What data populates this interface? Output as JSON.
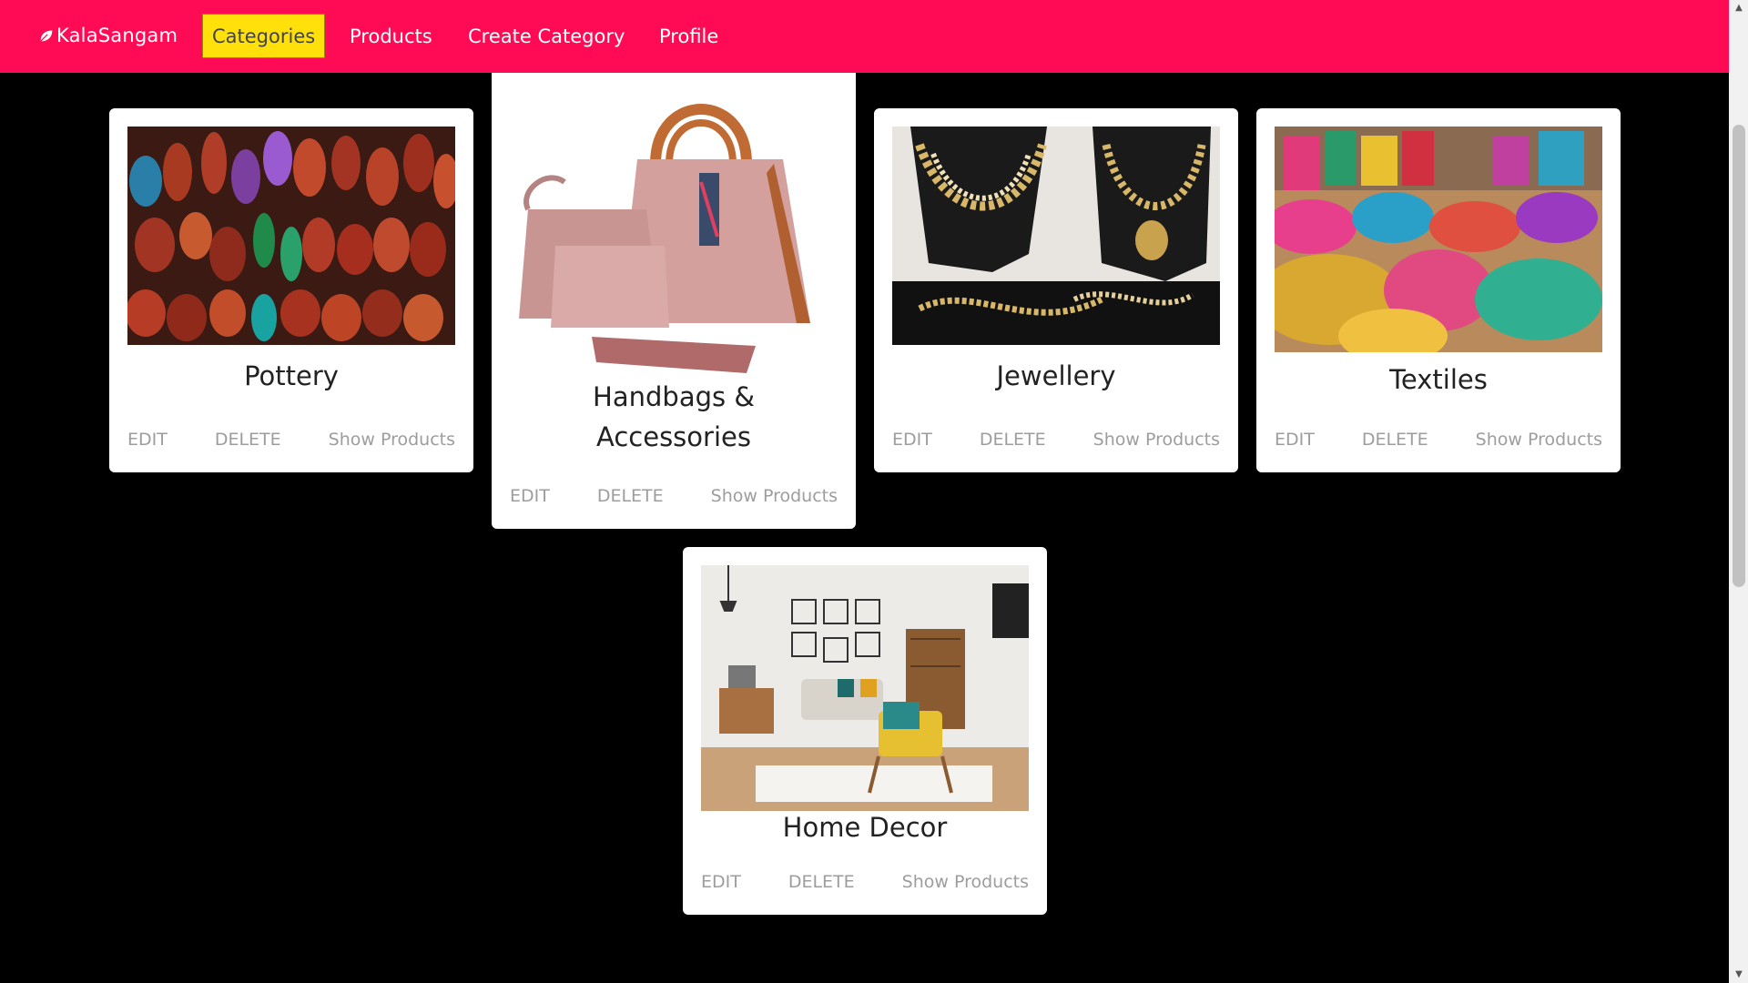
{
  "nav": {
    "brand": "KalaSangam",
    "links": [
      "Categories",
      "Products",
      "Create Category",
      "Profile"
    ],
    "active_index": 0,
    "colors": {
      "bar": "#ff0a54",
      "active_bg": "#ffe00a"
    }
  },
  "categories": [
    {
      "title": "Pottery",
      "image_icon": "pottery-photo",
      "edit": "EDIT",
      "delete": "DELETE",
      "show": "Show Products"
    },
    {
      "title_line1": "Handbags &",
      "title_line2": "Accessories",
      "image_icon": "handbag-photo",
      "edit": "EDIT",
      "delete": "DELETE",
      "show": "Show Products"
    },
    {
      "title": "Jewellery",
      "image_icon": "jewellery-photo",
      "edit": "EDIT",
      "delete": "DELETE",
      "show": "Show Products"
    },
    {
      "title": "Textiles",
      "image_icon": "textiles-photo",
      "edit": "EDIT",
      "delete": "DELETE",
      "show": "Show Products"
    },
    {
      "title": "Home Decor",
      "image_icon": "living-room-photo",
      "edit": "EDIT",
      "delete": "DELETE",
      "show": "Show Products"
    }
  ]
}
